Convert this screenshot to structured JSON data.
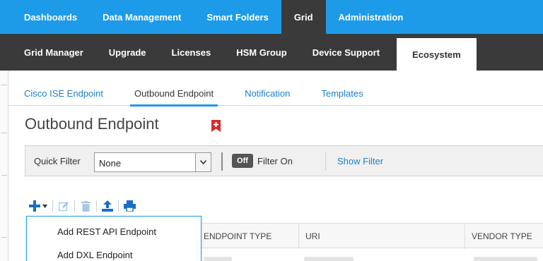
{
  "top_nav": {
    "items": [
      {
        "label": "Dashboards"
      },
      {
        "label": "Data Management"
      },
      {
        "label": "Smart Folders"
      },
      {
        "label": "Grid"
      },
      {
        "label": "Administration"
      }
    ],
    "active": "Grid"
  },
  "sub_nav": {
    "items": [
      {
        "label": "Grid Manager"
      },
      {
        "label": "Upgrade"
      },
      {
        "label": "Licenses"
      },
      {
        "label": "HSM Group"
      },
      {
        "label": "Device Support"
      },
      {
        "label": "Ecosystem"
      }
    ],
    "active": "Ecosystem"
  },
  "tabs": {
    "items": [
      {
        "label": "Cisco ISE Endpoint"
      },
      {
        "label": "Outbound Endpoint"
      },
      {
        "label": "Notification"
      },
      {
        "label": "Templates"
      }
    ],
    "active": "Outbound Endpoint"
  },
  "page": {
    "title": "Outbound Endpoint"
  },
  "filter": {
    "quick_filter_label": "Quick Filter",
    "quick_filter_value": "None",
    "toggle_label": "Off",
    "filter_on_label": "Filter On",
    "show_filter_label": "Show Filter"
  },
  "toolbar": {
    "icons": [
      "add-icon",
      "dropdown-caret-icon",
      "edit-icon",
      "delete-icon",
      "upload-icon",
      "print-icon"
    ]
  },
  "table": {
    "columns": [
      {
        "label": "ENDPOINT TYPE"
      },
      {
        "label": "URI"
      },
      {
        "label": "VENDOR TYPE"
      }
    ]
  },
  "add_menu": {
    "items": [
      {
        "label": "Add REST API Endpoint"
      },
      {
        "label": "Add DXL Endpoint"
      }
    ]
  },
  "colors": {
    "top_nav_bg": "#1e9be8",
    "sub_nav_bg": "#3a3a3a",
    "link": "#1a7fc9",
    "bookmark_red": "#d62b2b",
    "toolbar_blue": "#1a6fc4"
  }
}
